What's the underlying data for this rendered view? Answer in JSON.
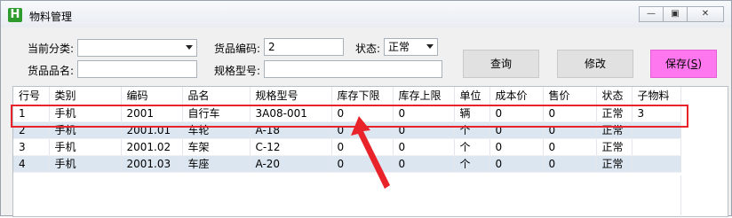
{
  "window": {
    "title": "物料管理",
    "app_icon_letter": "H"
  },
  "form": {
    "category_label": "当前分类:",
    "category_value": "",
    "code_label": "货品编码:",
    "code_value": "2",
    "status_label": "状态:",
    "status_value": "正常",
    "name_label": "货品品名:",
    "name_value": "",
    "spec_label": "规格型号:",
    "spec_value": ""
  },
  "buttons": {
    "query": "查询",
    "edit": "修改",
    "save": "保存(",
    "save_hotkey": "S",
    "save_close": ")"
  },
  "table": {
    "headers": [
      "行号",
      "类别",
      "编码",
      "品名",
      "规格型号",
      "库存下限",
      "库存上限",
      "单位",
      "成本价",
      "售价",
      "状态",
      "子物料"
    ],
    "rows": [
      [
        "1",
        "手机",
        "2001",
        "自行车",
        "3A08-001",
        "0",
        "0",
        "辆",
        "0",
        "0",
        "正常",
        "3"
      ],
      [
        "2",
        "手机",
        "2001.01",
        "车轮",
        "A-18",
        "0",
        "0",
        "个",
        "0",
        "0",
        "正常",
        ""
      ],
      [
        "3",
        "手机",
        "2001.02",
        "车架",
        "C-12",
        "0",
        "0",
        "个",
        "0",
        "0",
        "正常",
        ""
      ],
      [
        "4",
        "手机",
        "2001.03",
        "车座",
        "A-20",
        "0",
        "0",
        "个",
        "0",
        "0",
        "正常",
        ""
      ]
    ]
  },
  "colors": {
    "highlight": "#e8232a",
    "save_button": "#ff77ee",
    "alt_row": "#dce6f1"
  }
}
